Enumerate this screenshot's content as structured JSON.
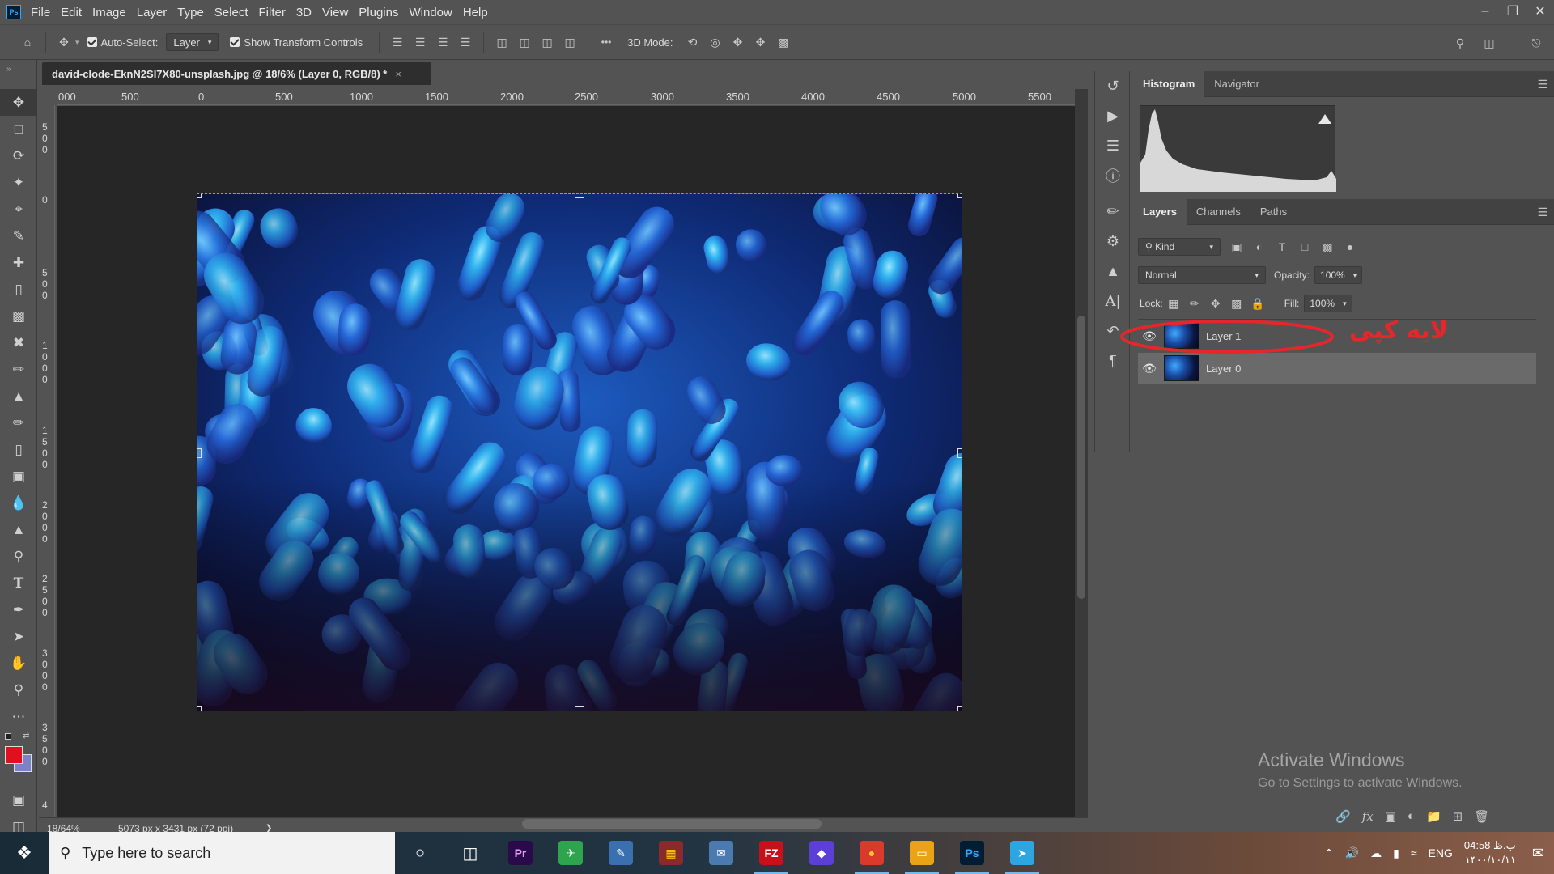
{
  "app": {
    "name": "Ps"
  },
  "menu": [
    "File",
    "Edit",
    "Image",
    "Layer",
    "Type",
    "Select",
    "Filter",
    "3D",
    "View",
    "Plugins",
    "Window",
    "Help"
  ],
  "window_controls": {
    "minimize": "–",
    "restore": "❐",
    "close": "✕"
  },
  "options": {
    "auto_select_label": "Auto-Select:",
    "auto_select_value": "Layer",
    "transform_label": "Show Transform Controls",
    "more": "•••",
    "mode_label": "3D Mode:"
  },
  "document": {
    "tab_title": "david-clode-EknN2SI7X80-unsplash.jpg @ 18/6% (Layer 0, RGB/8) *",
    "close": "×"
  },
  "rulers": {
    "top": [
      "000",
      "500",
      "0",
      "500",
      "1000",
      "1500",
      "2000",
      "2500",
      "3000",
      "3500",
      "4000",
      "4500",
      "5000",
      "5500"
    ],
    "left": [
      "5\n0\n0",
      "0",
      "5\n0\n0",
      "1\n0\n0\n0",
      "1\n5\n0\n0",
      "2\n0\n0\n0",
      "2\n5\n0\n0",
      "3\n0\n0\n0",
      "3\n5\n0\n0",
      "4"
    ]
  },
  "status": {
    "zoom": "18/64%",
    "doc_info": "5073 px x 3431 px (72 ppi)",
    "arrow": "❯"
  },
  "panels": {
    "top_tabs": [
      "Histogram",
      "Navigator"
    ],
    "layer_tabs": [
      "Layers",
      "Channels",
      "Paths"
    ],
    "kind_label": "Kind",
    "blend_mode": "Normal",
    "opacity_label": "Opacity:",
    "opacity_value": "100%",
    "lock_label": "Lock:",
    "fill_label": "Fill:",
    "fill_value": "100%",
    "layers": [
      {
        "name": "Layer 1",
        "selected": false
      },
      {
        "name": "Layer 0",
        "selected": true
      }
    ],
    "annotation": "لایه کپی"
  },
  "watermark": {
    "title": "Activate Windows",
    "subtitle": "Go to Settings to activate Windows."
  },
  "taskbar": {
    "search_placeholder": "Type here to search",
    "apps": [
      {
        "name": "Pr",
        "color": "#2a0a4a",
        "fg": "#e0a0ff"
      },
      {
        "name": "✈",
        "color": "#2ea44f",
        "fg": "#ffffff"
      },
      {
        "name": "✎",
        "color": "#3a6fb0",
        "fg": "#ffffff"
      },
      {
        "name": "▦",
        "color": "#8a2a2a",
        "fg": "#ffd700"
      },
      {
        "name": "✉",
        "color": "#4a7ab0",
        "fg": "#ffffff"
      },
      {
        "name": "FZ",
        "color": "#c8101a",
        "fg": "#ffffff"
      },
      {
        "name": "◆",
        "color": "#5b3fd6",
        "fg": "#ffffff"
      },
      {
        "name": "●",
        "color": "#d93a2b",
        "fg": "#f7c631"
      },
      {
        "name": "▭",
        "color": "#e8a317",
        "fg": "#ffffff"
      },
      {
        "name": "Ps",
        "color": "#001d34",
        "fg": "#31a8ff"
      },
      {
        "name": "➤",
        "color": "#2ca5e0",
        "fg": "#ffffff"
      }
    ],
    "lang": "ENG",
    "time": "04:58 ب.ظ",
    "date": "۱۴۰۰/۱۰/۱۱"
  }
}
